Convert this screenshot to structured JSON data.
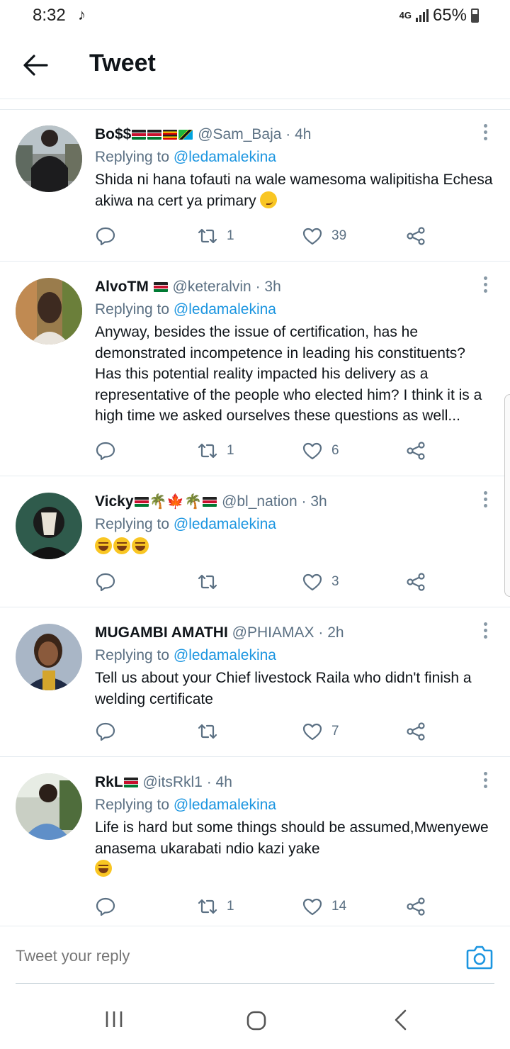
{
  "status_bar": {
    "time": "8:32",
    "music_note": "♪",
    "network": "4G",
    "battery": "65%"
  },
  "header": {
    "title": "Tweet"
  },
  "tweets": [
    {
      "name": "Bo$$",
      "name_suffix": "🇰🇪🇰🇪🇺🇬🇹🇿",
      "handle": "@Sam_Baja",
      "separator": "·",
      "time": "4h",
      "replying_prefix": "Replying to",
      "replying_to": "@ledamalekina",
      "text": "Shida ni hana tofauti na wale wamesoma walipitisha Echesa akiwa na cert ya primary",
      "emoji": "😏",
      "retweets": "1",
      "likes": "39"
    },
    {
      "name": "AlvoTM",
      "name_suffix": "🇰🇪",
      "handle": "@keteralvin",
      "separator": "·",
      "time": "3h",
      "replying_prefix": "Replying to",
      "replying_to": "@ledamalekina",
      "text": "Anyway, besides the issue of certification, has he demonstrated incompetence in leading his constituents? Has this potential reality impacted his delivery as a representative of the people who elected him? I think it is a high time we asked ourselves these questions as well...",
      "retweets": "1",
      "likes": "6"
    },
    {
      "name": "Vicky",
      "name_suffix": "🇰🇪🌴🍁🌴🇰🇪",
      "handle": "@bl_nation",
      "separator": "·",
      "time": "3h",
      "replying_prefix": "Replying to",
      "replying_to": "@ledamalekina",
      "text": "😂😂😂",
      "retweets": "",
      "likes": "3"
    },
    {
      "name": "MUGAMBI AMATHI",
      "name_suffix": "",
      "handle": "@PHIAMAX",
      "separator": "·",
      "time": "2h",
      "replying_prefix": "Replying to",
      "replying_to": "@ledamalekina",
      "text": "Tell us about your Chief livestock Raila who didn't finish a welding certificate",
      "retweets": "",
      "likes": "7"
    },
    {
      "name": "RkL",
      "name_suffix": "🇰🇪",
      "handle": "@itsRkl1",
      "separator": "·",
      "time": "4h",
      "replying_prefix": "Replying to",
      "replying_to": "@ledamalekina",
      "text": "Life is hard but some things should be assumed,Mwenyewe anasema ukarabati ndio kazi yake",
      "emoji": "😂",
      "retweets": "1",
      "likes": "14"
    }
  ],
  "reply_bar": {
    "placeholder": "Tweet your reply"
  },
  "icons": {
    "back": "arrow-left-icon",
    "more": "more-vertical-icon",
    "reply": "comment-icon",
    "retweet": "retweet-icon",
    "like": "heart-icon",
    "share": "share-icon",
    "camera": "camera-icon"
  },
  "colors": {
    "accent": "#1b95e0",
    "secondary_text": "#5b7083",
    "divider": "#e6ecf0"
  }
}
